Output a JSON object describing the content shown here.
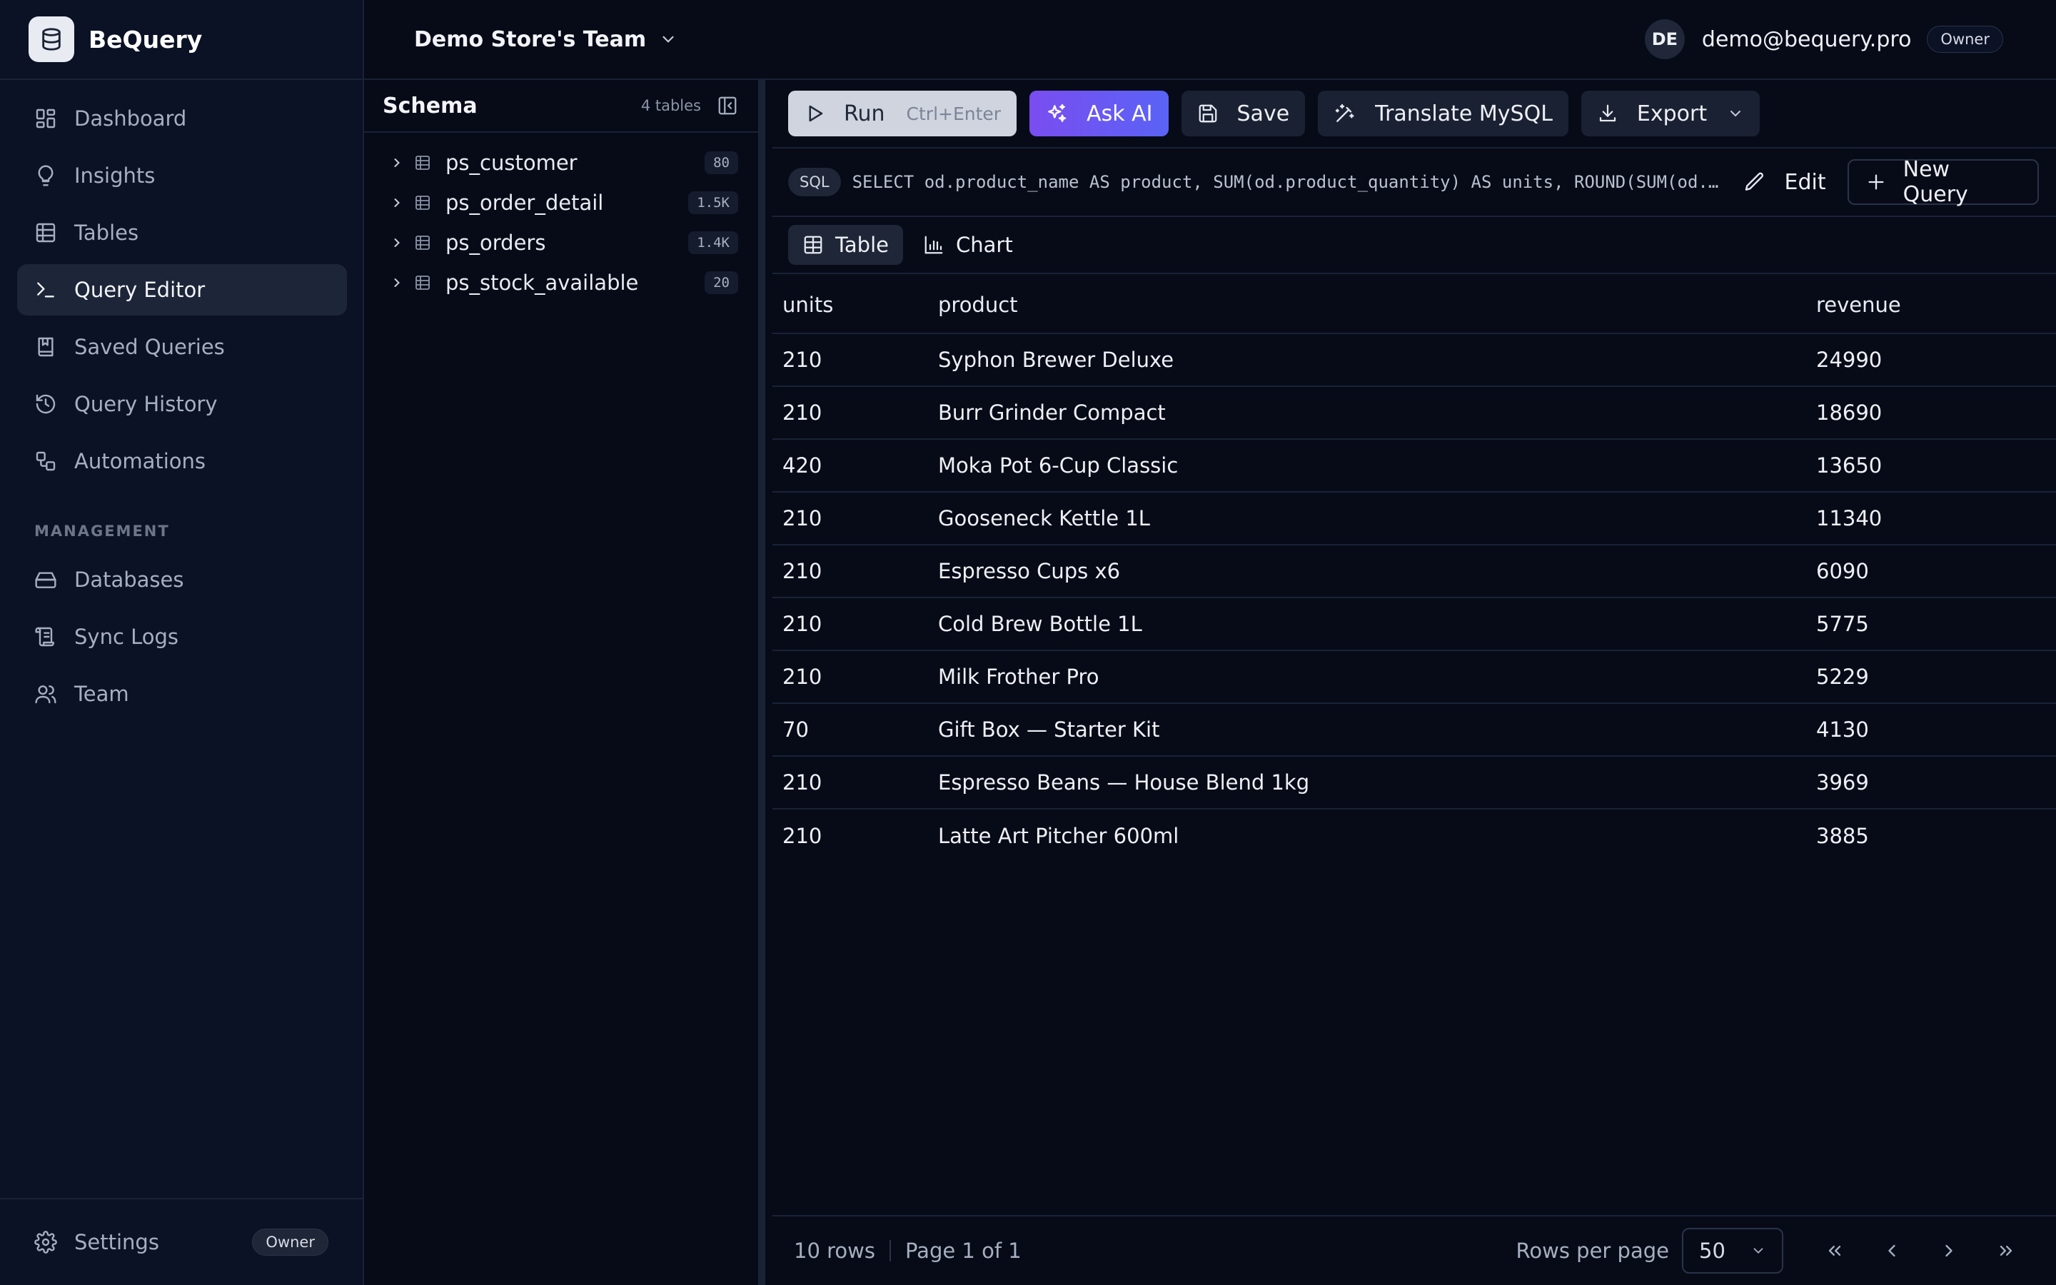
{
  "brand": {
    "name": "BeQuery"
  },
  "nav": {
    "items": [
      {
        "label": "Dashboard",
        "icon": "dashboard-icon"
      },
      {
        "label": "Insights",
        "icon": "lightbulb-icon"
      },
      {
        "label": "Tables",
        "icon": "table-icon"
      },
      {
        "label": "Query Editor",
        "icon": "terminal-icon",
        "active": true
      },
      {
        "label": "Saved Queries",
        "icon": "bookmark-book-icon"
      },
      {
        "label": "Query History",
        "icon": "history-icon"
      },
      {
        "label": "Automations",
        "icon": "workflow-icon"
      }
    ],
    "management_label": "MANAGEMENT",
    "management_items": [
      {
        "label": "Databases",
        "icon": "hard-drive-icon"
      },
      {
        "label": "Sync Logs",
        "icon": "scroll-icon"
      },
      {
        "label": "Team",
        "icon": "users-icon"
      }
    ],
    "settings_label": "Settings",
    "settings_badge": "Owner"
  },
  "header": {
    "team_name": "Demo Store's Team",
    "avatar_initials": "DE",
    "user_email": "demo@bequery.pro",
    "role_badge": "Owner"
  },
  "schema": {
    "title": "Schema",
    "count_label": "4 tables",
    "tables": [
      {
        "name": "ps_customer",
        "rows": "80"
      },
      {
        "name": "ps_order_detail",
        "rows": "1.5K"
      },
      {
        "name": "ps_orders",
        "rows": "1.4K"
      },
      {
        "name": "ps_stock_available",
        "rows": "20"
      }
    ]
  },
  "toolbar": {
    "run_label": "Run",
    "run_shortcut": "Ctrl+Enter",
    "ask_ai_label": "Ask AI",
    "save_label": "Save",
    "translate_label": "Translate MySQL",
    "export_label": "Export"
  },
  "query": {
    "tag": "SQL",
    "text": "SELECT od.product_name AS product, SUM(od.product_quantity) AS units, ROUND(SUM(od.tot…",
    "edit_label": "Edit",
    "new_query_label": "New Query"
  },
  "view_tabs": {
    "table_label": "Table",
    "chart_label": "Chart"
  },
  "results": {
    "columns": [
      "units",
      "product",
      "revenue"
    ],
    "rows": [
      [
        "210",
        "Syphon Brewer Deluxe",
        "24990"
      ],
      [
        "210",
        "Burr Grinder Compact",
        "18690"
      ],
      [
        "420",
        "Moka Pot 6-Cup Classic",
        "13650"
      ],
      [
        "210",
        "Gooseneck Kettle 1L",
        "11340"
      ],
      [
        "210",
        "Espresso Cups x6",
        "6090"
      ],
      [
        "210",
        "Cold Brew Bottle 1L",
        "5775"
      ],
      [
        "210",
        "Milk Frother Pro",
        "5229"
      ],
      [
        "70",
        "Gift Box — Starter Kit",
        "4130"
      ],
      [
        "210",
        "Espresso Beans — House Blend 1kg",
        "3969"
      ],
      [
        "210",
        "Latte Art Pitcher 600ml",
        "3885"
      ]
    ]
  },
  "footer": {
    "row_count": "10 rows",
    "page_info": "Page 1 of 1",
    "rows_per_page_label": "Rows per page",
    "rows_per_page_value": "50"
  },
  "colors": {
    "background": "#070b18",
    "sidebar": "#0b1226",
    "accent_ai_start": "#7a4df0",
    "accent_ai_end": "#5a63f6"
  }
}
